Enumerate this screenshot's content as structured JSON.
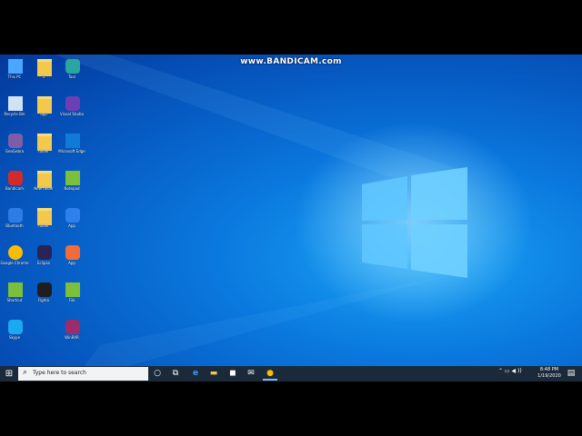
{
  "watermark": "www.BANDICAM.com",
  "desktop_icons": [
    {
      "label": "This PC",
      "kind": "pc",
      "color": "#4aa6ff"
    },
    {
      "label": "Recycle Bin",
      "kind": "bin",
      "color": "#cfe3f5"
    },
    {
      "label": "GeoGebra",
      "kind": "app",
      "color": "#7b5ea7"
    },
    {
      "label": "Bandicam",
      "kind": "app",
      "color": "#d12b2b"
    },
    {
      "label": "Bluetooth",
      "kind": "app",
      "color": "#2d7be5"
    },
    {
      "label": "Google Chrome",
      "kind": "chrome",
      "color": "#fbbc05"
    },
    {
      "label": "Shortcut",
      "kind": "file",
      "color": "#7bbf3a"
    },
    {
      "label": "Skype",
      "kind": "app",
      "color": "#1ba9f0"
    },
    {
      "label": "1",
      "kind": "folder",
      "color": "#f2c94c"
    },
    {
      "label": "app",
      "kind": "folder",
      "color": "#f2c94c"
    },
    {
      "label": "folder",
      "kind": "folder",
      "color": "#f2c94c"
    },
    {
      "label": "New folder",
      "kind": "folder",
      "color": "#f2c94c"
    },
    {
      "label": "folder",
      "kind": "folder",
      "color": "#f2c94c"
    },
    {
      "label": "Eclipse",
      "kind": "app",
      "color": "#2c2255"
    },
    {
      "label": "Figma",
      "kind": "app",
      "color": "#1e1e1e"
    },
    {
      "label": "Tool",
      "kind": "app",
      "color": "#2aa5a0"
    },
    {
      "label": "Visual Studio",
      "kind": "app",
      "color": "#6c3fb3"
    },
    {
      "label": "Microsoft Edge",
      "kind": "edge",
      "color": "#0f7bd6"
    },
    {
      "label": "Notepad",
      "kind": "file",
      "color": "#7bbf3a"
    },
    {
      "label": "App",
      "kind": "app",
      "color": "#2f80ed"
    },
    {
      "label": "App",
      "kind": "app",
      "color": "#f26b38"
    },
    {
      "label": "File",
      "kind": "file",
      "color": "#7bbf3a"
    },
    {
      "label": "WinRAR",
      "kind": "app",
      "color": "#9b2d6f"
    }
  ],
  "taskbar": {
    "start_glyph": "⊞",
    "search_placeholder": "Type here to search",
    "search_glyph": "⌕",
    "cortana_glyph": "○",
    "taskview_glyph": "⧉",
    "edge_glyph": "e",
    "explorer_glyph": "▬",
    "store_glyph": "◼",
    "mail_glyph": "✉",
    "chrome_glyph": "●",
    "tray_text": "⌃ ▭ ◀ ))",
    "time": "8:48 PM",
    "date": "1/19/2020",
    "notification_glyph": "▤"
  },
  "colors": {
    "taskbar": "#1a2a3a",
    "desktop_light": "#1aa3f5",
    "desktop_dark": "#03389a"
  }
}
